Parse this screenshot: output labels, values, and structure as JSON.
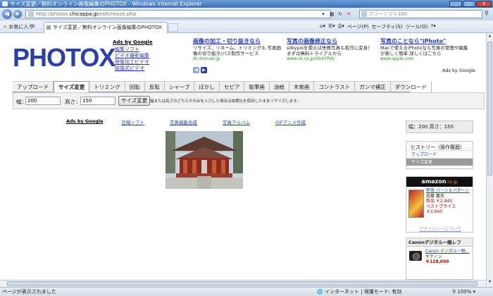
{
  "window": {
    "title": "サイズ変更／無料オンライン画像編集のPHOTOX - Windows Internet Explorer",
    "controls": [
      "_",
      "□",
      "X"
    ]
  },
  "address": {
    "url_prefix": "http://photox.",
    "url_domain": "chicappa.jp",
    "url_suffix": "/edit/resize.php",
    "search_placeholder": "フリーソフト100"
  },
  "favbar": {
    "favorites_label": "お気に入り",
    "tab_title": "サイズ変更／無料オンライン画像編集のPHOTOX",
    "tools": [
      "ページ(P)",
      "セーフティ(S)",
      "ツール(O)"
    ]
  },
  "header": {
    "logo": "PHOTOX",
    "ads_heading": "Ads by Google",
    "ads_links": [
      "編集ソフト",
      "ビデオ撮影編集",
      "映像加工ビデオ",
      "結婚式ビデオ"
    ],
    "ads": [
      {
        "title": "画像の加工・切り抜きなら",
        "desc": "リサイズ、リネーム、トリミングも 写真画像の切り抜き/パス制作サービス",
        "url": "dc-kirinuki.jp"
      },
      {
        "title": "写真の画像修正なら",
        "desc": "silkypixを使えば失敗写真も名作に変身！まずは無料トライアルから",
        "url": "www.isl.co.jp/SILKYPIX/"
      },
      {
        "title": "写真のことなら\"iPhoto\"",
        "desc": "Macで使えるiPhotoなら写真の管理や編集が楽しく簡単 詳しくはこちら",
        "url": "www.apple.com"
      }
    ],
    "ads_by_google": "Ads by Google"
  },
  "menu": {
    "items": [
      "アップロード",
      "サイズ変更",
      "トリミング",
      "回転",
      "反転",
      "シャープ",
      "ぼかし",
      "セピア",
      "鉛筆画",
      "油絵",
      "木炭画",
      "コントラスト",
      "ガンマ補正",
      "ダウンロード"
    ],
    "active": "サイズ変更"
  },
  "resize": {
    "width_label": "幅：",
    "width_value": "200",
    "height_label": "高さ：",
    "height_value": "150",
    "button": "サイズ変更",
    "note": "幅または高さのどちらかのみを入力した場合は縦横比を保持したままリサイズします。"
  },
  "linkbar": {
    "ads": "Ads by Google",
    "links": [
      "圧縮ソフト",
      "写真編集合成",
      "写真アルバム",
      "GIFアニメ作成"
    ]
  },
  "sidebar": {
    "size_text": "幅：200 高さ：150",
    "history_title": "ヒストリー（操作履歴）",
    "history_items": [
      "アップロード",
      "サイズ変更"
    ],
    "amazon": {
      "brand": "amazon",
      "suffix": ".co.jp",
      "title": "新版 パーン＆パターン",
      "author": "武藤 義夫",
      "new_price": "新品 ￥2,940",
      "best_price": "ベストプライス",
      "price2": "￥2,940",
      "privacy": "プライバシーについて"
    },
    "canon": {
      "heading": "Canonデジタル一眼レフ",
      "title": "Canon デジタル一眼...",
      "maker": "キヤノン",
      "price": "￥128,000"
    }
  },
  "status": {
    "left": "ページが表示されました",
    "zone": "インターネット | 保護モード: 有効",
    "zoom": "100%"
  },
  "colors": {
    "logo": "#2b3fa6",
    "link": "#1f3fb0",
    "titlebar": "#3a6fb5"
  }
}
